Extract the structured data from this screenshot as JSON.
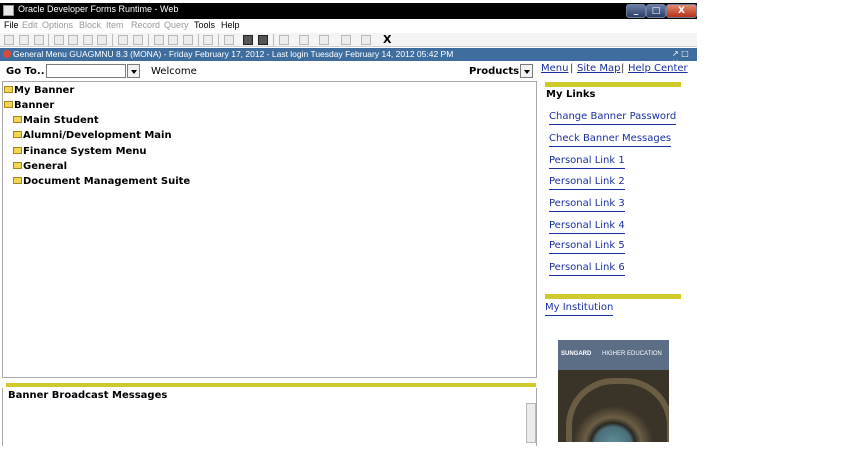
{
  "window": {
    "title": "Oracle Developer Forms Runtime - Web",
    "controls": {
      "minimize": "_",
      "maximize": "□",
      "close": "X"
    }
  },
  "menubar": [
    {
      "label": "File",
      "enabled": true
    },
    {
      "label": "Edit",
      "enabled": false
    },
    {
      "label": "Options",
      "enabled": false
    },
    {
      "label": "Block",
      "enabled": false
    },
    {
      "label": "Item",
      "enabled": false
    },
    {
      "label": "Record",
      "enabled": false
    },
    {
      "label": "Query",
      "enabled": false
    },
    {
      "label": "Tools",
      "enabled": true
    },
    {
      "label": "Help",
      "enabled": true
    }
  ],
  "toolbar": {
    "exit_label": "X"
  },
  "form_header": {
    "text": "General Menu  GUAGMNU  8.3  (MONA) - Friday February 17, 2012 - Last login Tuesday February 14, 2012 05:42 PM",
    "controls": "↗ □ ×"
  },
  "goto": {
    "label": "Go To..",
    "value": "",
    "welcome": "Welcome"
  },
  "products": {
    "label": "Products:"
  },
  "tree": {
    "items": [
      {
        "label": "My Banner",
        "level": 0
      },
      {
        "label": "Banner",
        "level": 0
      },
      {
        "label": "Main Student",
        "level": 1
      },
      {
        "label": "Alumni/Development Main",
        "level": 1
      },
      {
        "label": "Finance System Menu",
        "level": 1
      },
      {
        "label": "General",
        "level": 1
      },
      {
        "label": "Document Management Suite",
        "level": 1
      }
    ]
  },
  "broadcast": {
    "title": "Banner Broadcast Messages"
  },
  "top_links": {
    "menu": "Menu",
    "site_map": "Site Map",
    "help_center": "Help Center",
    "separator": "|"
  },
  "my_links": {
    "title": "My Links",
    "items": [
      "Change Banner Password",
      "Check Banner Messages",
      "Personal Link 1",
      "Personal Link 2",
      "Personal Link 3",
      "Personal Link 4",
      "Personal Link 5",
      "Personal Link 6"
    ]
  },
  "my_institution": {
    "label": "My Institution"
  },
  "logo": {
    "brand": "SUNGARD",
    "tagline": "HIGHER EDUCATION"
  },
  "colors": {
    "title_bar": "#000000",
    "form_header": "#3f6e9e",
    "accent_bar": "#cfc92b",
    "link": "#1a2fa0"
  }
}
